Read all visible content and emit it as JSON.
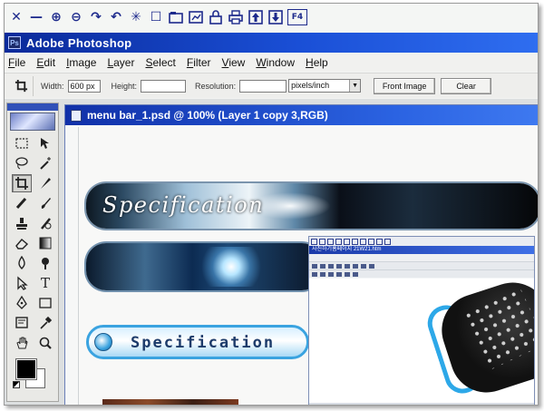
{
  "app": {
    "title": "Adobe Photoshop",
    "logo_label": "Ps"
  },
  "toolbar": {
    "icons": [
      "close-icon",
      "minimize-icon",
      "zoom-in-icon",
      "zoom-out-icon",
      "redo-icon",
      "undo-icon",
      "asterisk-icon",
      "square-icon",
      "folder-icon",
      "chart-icon",
      "lock-icon",
      "print-icon",
      "arrow-up-icon",
      "arrow-down-icon",
      "f4-icon"
    ],
    "glyphs": [
      "✕",
      "—",
      "⊕",
      "⊖",
      "↷",
      "↶",
      "✳",
      "☐",
      "🗀",
      "⊞",
      "🔒",
      "⎙",
      "⇧",
      "⇩"
    ],
    "f4_label": "F4"
  },
  "menu": {
    "items": [
      "File",
      "Edit",
      "Image",
      "Layer",
      "Select",
      "Filter",
      "View",
      "Window",
      "Help"
    ]
  },
  "options": {
    "width_label": "Width:",
    "width_value": "600 px",
    "height_label": "Height:",
    "height_value": "",
    "resolution_label": "Resolution:",
    "resolution_value": "",
    "resolution_unit": "pixels/inch",
    "front_image_label": "Front Image",
    "clear_label": "Clear"
  },
  "document": {
    "title": "menu bar_1.psd @ 100% (Layer 1 copy 3,RGB)",
    "banners": [
      {
        "text": "Specification"
      },
      {
        "text": ""
      },
      {
        "text": "Specification"
      }
    ]
  },
  "overlay": {
    "title": "사진하기홈페이지 21W21.htm"
  },
  "colors": {
    "titlebar": "#1a4fd6",
    "foreground": "#000000",
    "background": "#ffffff",
    "accent": "#3aa3e0"
  }
}
